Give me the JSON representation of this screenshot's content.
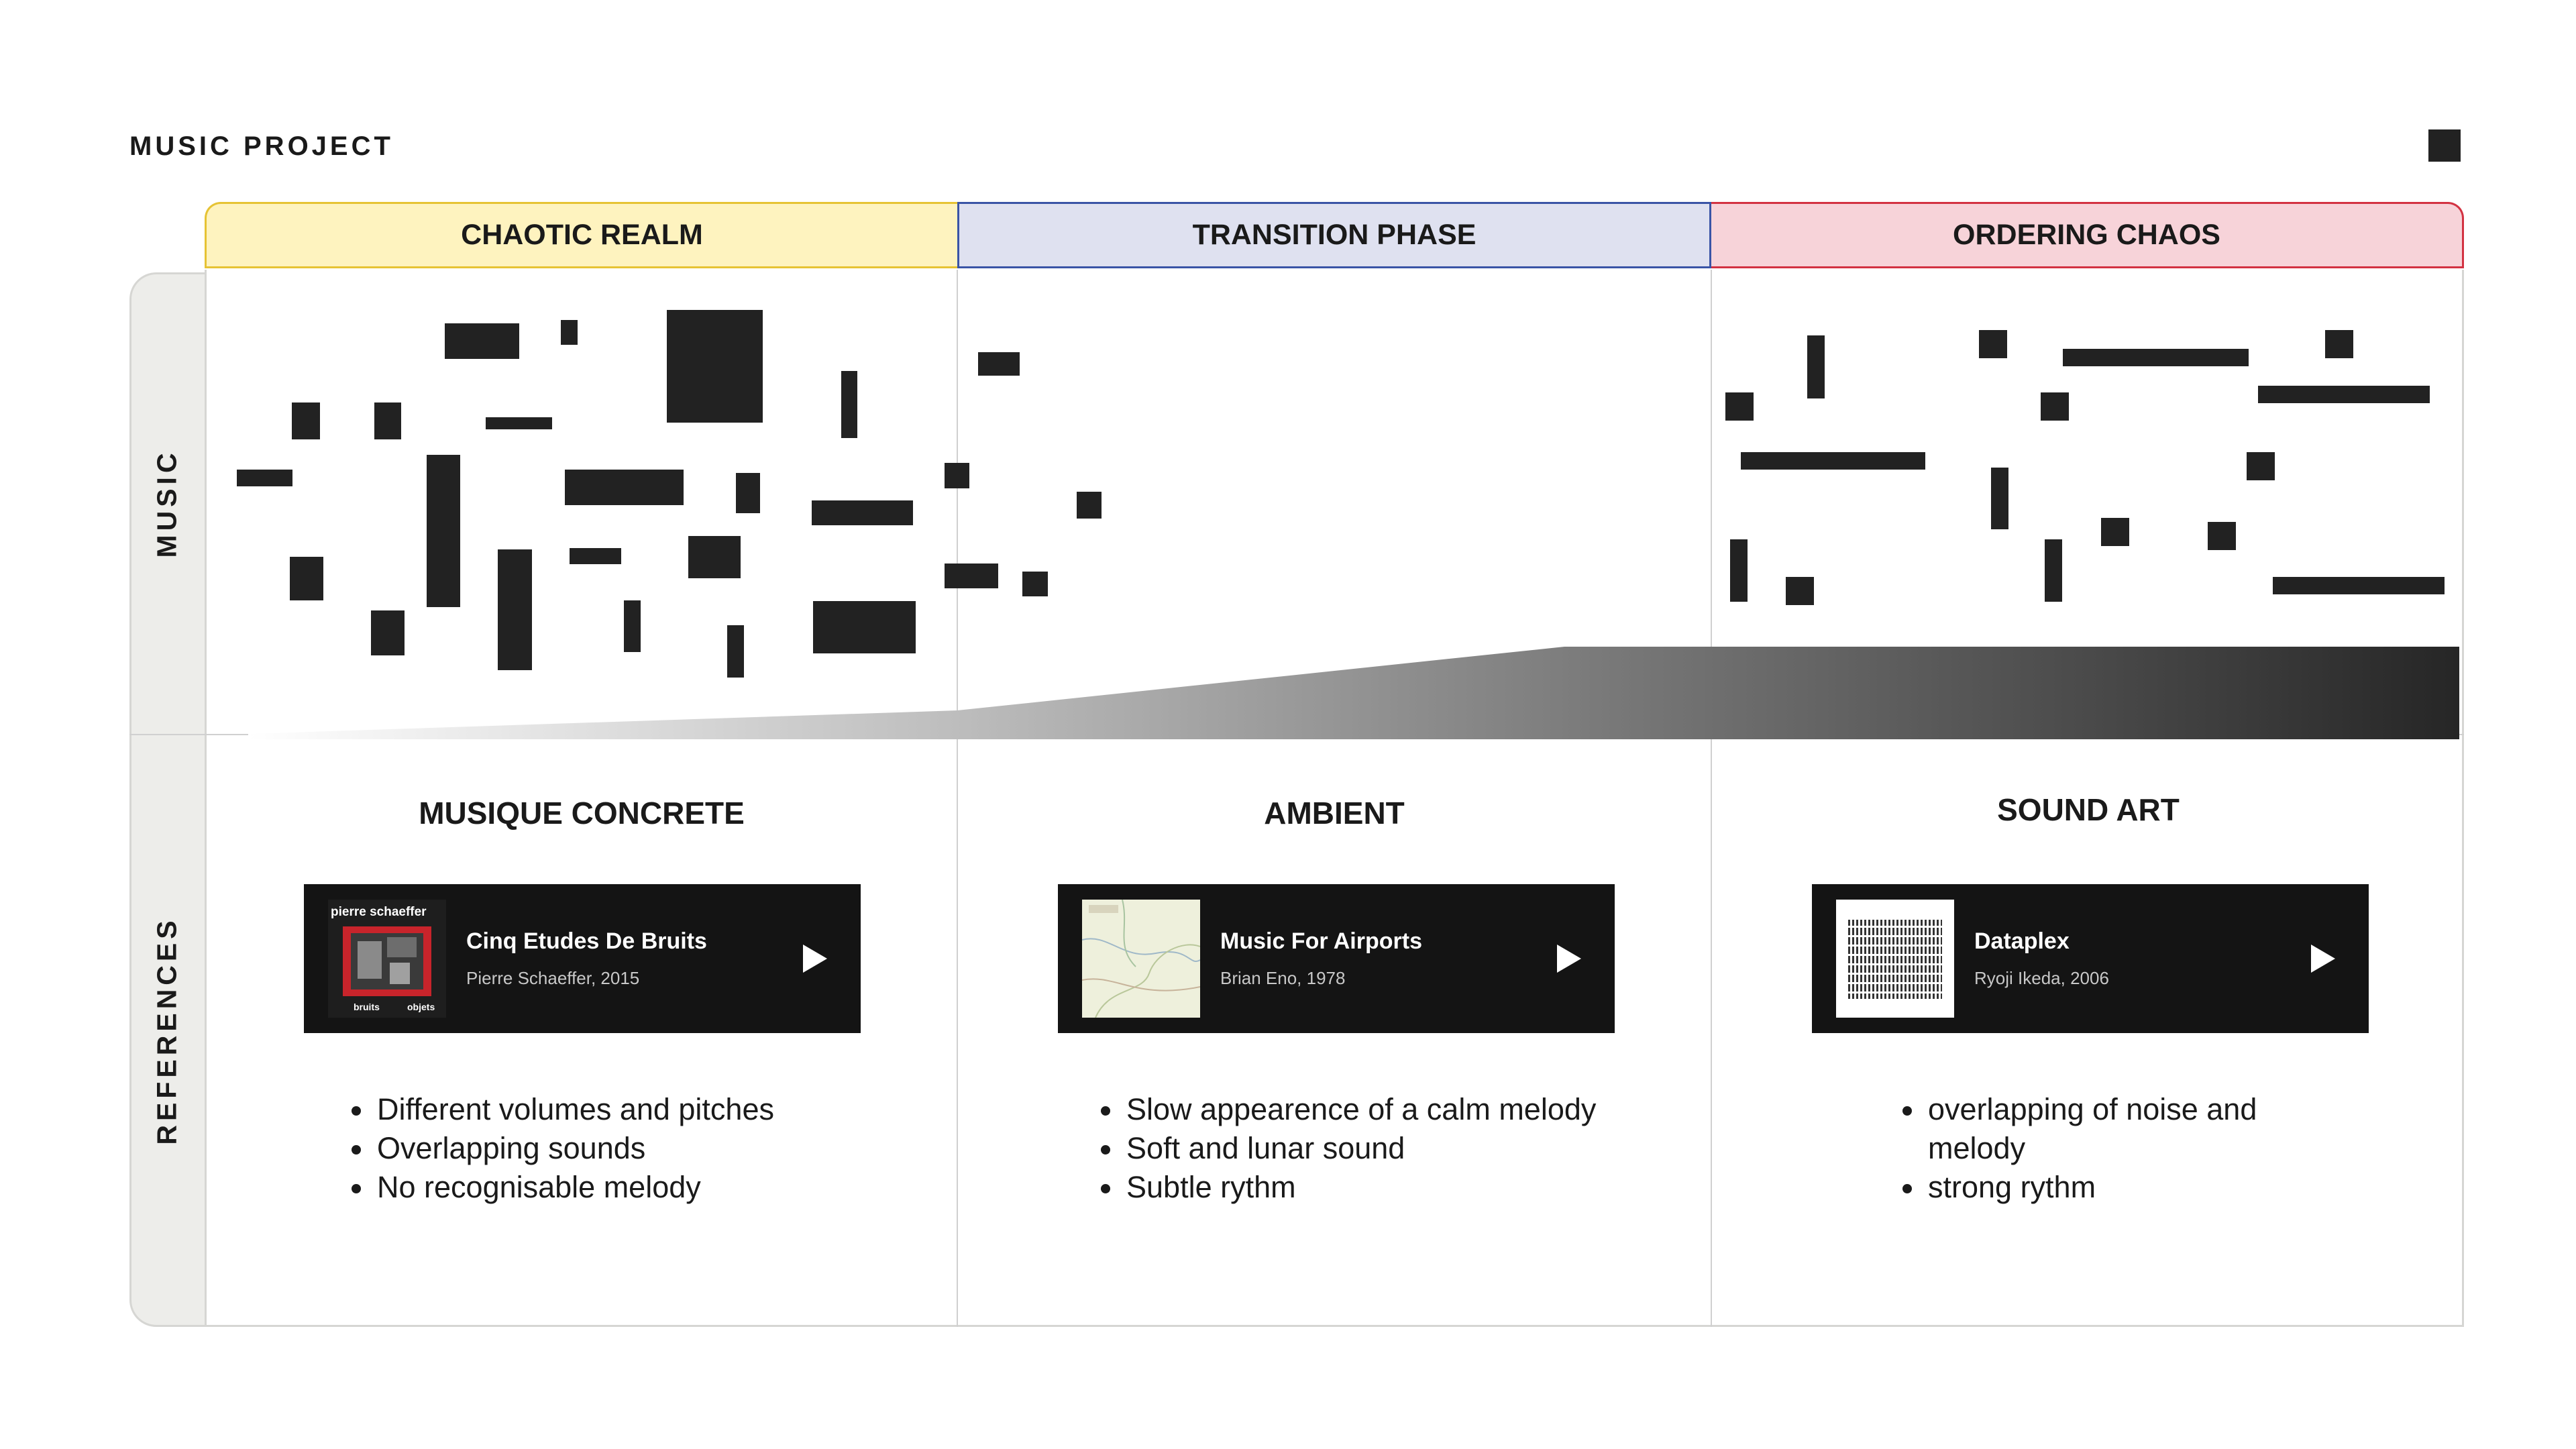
{
  "page_title": "MUSIC PROJECT",
  "columns": [
    {
      "header": "CHAOTIC REALM",
      "header_bg": "#fef3bf",
      "border_color": "#e6c334"
    },
    {
      "header": "TRANSITION PHASE",
      "header_bg": "#dfe1f0",
      "border_color": "#3a54a6"
    },
    {
      "header": "ORDERING CHAOS",
      "header_bg": "#f7d3d9",
      "border_color": "#d33242"
    }
  ],
  "rows": [
    "MUSIC",
    "REFERENCES"
  ],
  "references": [
    {
      "section_title": "MUSIQUE CONCRETE",
      "track_title": "Cinq Etudes De Bruits",
      "track_sub": "Pierre Schaeffer, 2015",
      "cover_text": {
        "top": "pierre schaeffer",
        "bottom_left": "bruits",
        "bottom_right": "objets"
      },
      "bullets": [
        "Different volumes and pitches",
        "Overlapping sounds",
        "No recognisable melody"
      ]
    },
    {
      "section_title": "AMBIENT",
      "track_title": "Music For Airports",
      "track_sub": "Brian Eno, 1978",
      "bullets": [
        "Slow appearence of a calm melody",
        "Soft and lunar sound",
        "Subtle rythm"
      ]
    },
    {
      "section_title": "SOUND ART",
      "track_title": "Dataplex",
      "track_sub": "Ryoji Ikeda, 2006",
      "bullets": [
        "overlapping of noise and melody",
        "strong rythm"
      ]
    }
  ]
}
